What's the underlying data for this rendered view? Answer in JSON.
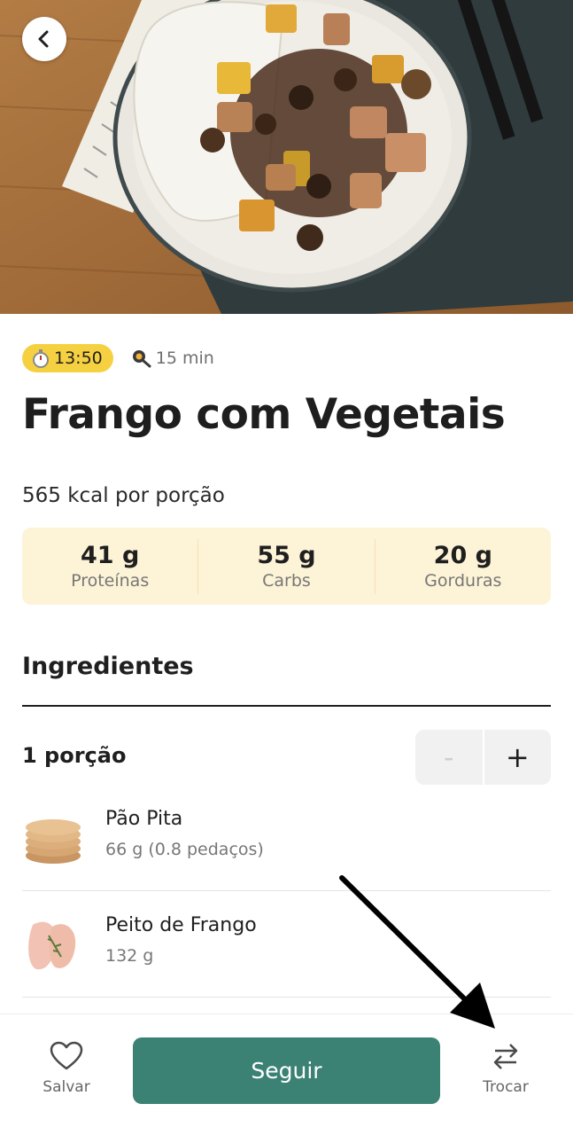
{
  "hero": {
    "image": "frango-com-vegetais-photo"
  },
  "header": {
    "back_icon": "chevron-left-icon"
  },
  "meta": {
    "time": "13:50",
    "time_icon": "stopwatch-icon",
    "prep": "15 min",
    "prep_icon": "cooking-pan-icon"
  },
  "recipe": {
    "title": "Frango com Vegetais",
    "kcal": "565 kcal por porção"
  },
  "macros": [
    {
      "value": "41 g",
      "label": "Proteínas"
    },
    {
      "value": "55 g",
      "label": "Carbs"
    },
    {
      "value": "20 g",
      "label": "Gorduras"
    }
  ],
  "ingredients_section": {
    "title": "Ingredientes",
    "portion_label": "1 porção",
    "minus": "-",
    "plus": "+",
    "items": [
      {
        "name": "Pão Pita",
        "qty": "66 g (0.8 pedaços)"
      },
      {
        "name": "Peito de Frango",
        "qty": "132 g"
      }
    ]
  },
  "bottom_bar": {
    "save_label": "Salvar",
    "follow_label": "Seguir",
    "swap_label": "Trocar"
  },
  "colors": {
    "accent": "#3b8274",
    "time_badge": "#f5d142",
    "macro_bg": "#fdf3d6"
  }
}
